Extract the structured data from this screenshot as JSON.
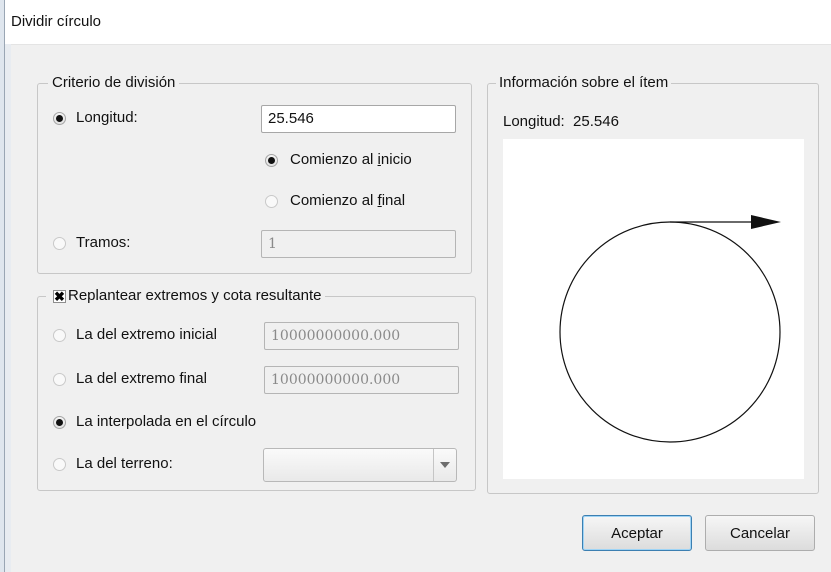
{
  "window": {
    "title": "Dividir círculo"
  },
  "criterio": {
    "legend": "Criterio de división",
    "longitud_label": "Longitud:",
    "longitud_value": "25.546",
    "longitud_selected": true,
    "comienzo_inicio_pre": "Comienzo al ",
    "comienzo_inicio_acc": "i",
    "comienzo_inicio_post": "nicio",
    "comienzo_inicio_selected": true,
    "comienzo_final_pre": "Comienzo al ",
    "comienzo_final_acc": "f",
    "comienzo_final_post": "inal",
    "comienzo_final_selected": false,
    "tramos_label": "Tramos:",
    "tramos_value": "1",
    "tramos_selected": false
  },
  "replantear": {
    "legend": "Replantear extremos y cota resultante",
    "checked": true,
    "check_mark": "✖",
    "inicial_label": "La del extremo inicial",
    "inicial_value": "10000000000.000",
    "final_label": "La del extremo final",
    "final_value": "10000000000.000",
    "interpolada_label": "La interpolada en el círculo",
    "interpolada_selected": true,
    "terreno_label": "La del terreno:",
    "terreno_value": ""
  },
  "info": {
    "legend": "Información sobre el ítem",
    "longitud_text": "Longitud:  25.546"
  },
  "buttons": {
    "accept": "Aceptar",
    "cancel": "Cancelar"
  },
  "icons": {
    "dropdown": "chevron-down-icon",
    "preview": "circle-arrow-preview"
  }
}
